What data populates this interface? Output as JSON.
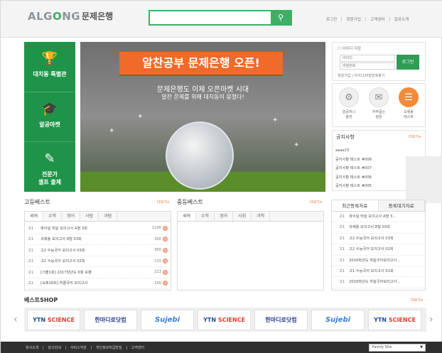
{
  "header": {
    "logo_text_a": "ALG",
    "logo_text_o": "O",
    "logo_text_b": "NG",
    "logo_sub": "문제은행",
    "search_placeholder": "",
    "search_icon": "search-icon",
    "nav": [
      "로그인",
      "회원가입",
      "고객센터",
      "알공소개"
    ]
  },
  "left_nav": [
    {
      "label": "대치동 특별관",
      "icon": "trophy-icon"
    },
    {
      "label": "알공마켓",
      "icon": "graduation-cap-icon"
    },
    {
      "label_line1": "전문가",
      "label_line2": "셀프 출제",
      "icon": "edit-icon"
    }
  ],
  "banner": {
    "title": "알찬공부 문제은행 오픈!",
    "line1": "문제은행도 이제 오픈마켓 시대",
    "line2": "알찬 문제를 위해 대치동이 뭉쳤다!"
  },
  "login": {
    "remember": "아이디 저장",
    "id_placeholder": "아이디",
    "pw_placeholder": "비밀번호",
    "button": "로그인",
    "signup": "회원가입",
    "find": "아이디/비밀번호찾기"
  },
  "quick_links": [
    {
      "label_line1": "알공머니",
      "label_line2": "충전",
      "icon": "coin-icon"
    },
    {
      "label_line1": "자주묻는",
      "label_line2": "질문",
      "icon": "chat-icon"
    },
    {
      "label_line1": "오랫동",
      "label_line2": "테스트",
      "icon": "document-icon"
    }
  ],
  "notice": {
    "title": "공지사항",
    "more": "더보기+",
    "items": [
      "aaaa23",
      "공지사항 테스트 #008",
      "공지사항 테스트 #007",
      "공지사항 테스트 #006",
      "공지사항 테스트 #005"
    ]
  },
  "high_best": {
    "title": "고등베스트",
    "more": "더보기+",
    "tabs": [
      "국어",
      "수학",
      "영어",
      "사탐",
      "과탐"
    ],
    "rows": [
      {
        "grade": "고1",
        "name": "파이널 하늘 모의고사 A형 3회",
        "count": "1100"
      },
      {
        "grade": "고1",
        "name": "과제용 모의고사 8형 03회",
        "count": "300"
      },
      {
        "grade": "고1",
        "name": "고2 수능국어 모의고사 03회",
        "count": "300"
      },
      {
        "grade": "고1",
        "name": "고2 수능국어 모의고사 02회",
        "count": "115"
      },
      {
        "grade": "고1",
        "name": "[기출1회] 2017학년도 6월 모평",
        "count": "222"
      },
      {
        "grade": "고1",
        "name": "[숙제16회] 허클국어 모의고사",
        "count": "100"
      }
    ]
  },
  "mid_best": {
    "title": "중등베스트",
    "more": "더보기+",
    "tabs": [
      "국어",
      "수학",
      "영어",
      "사회",
      "과학"
    ]
  },
  "recent": {
    "tab1": "최근등록자료",
    "tab2": "등록대기자료",
    "rows": [
      {
        "grade": "고1",
        "name": "파이널 하늘 모의고사 A형 3..."
      },
      {
        "grade": "고1",
        "name": "과제용 모의고사 8형 03회"
      },
      {
        "grade": "고1",
        "name": "고2 수능국어 모의고사 03회"
      },
      {
        "grade": "고1",
        "name": "고2 수능국어 모의고사 02회"
      },
      {
        "grade": "고1",
        "name": "2016학년도 하늘국어모의고사..."
      },
      {
        "grade": "고1",
        "name": "고1 수능국어 모의고사 01회"
      },
      {
        "grade": "고1",
        "name": "2016학년도 하늘국어모의고사..."
      }
    ]
  },
  "shop": {
    "title": "베스트SHOP",
    "more": "더보기+",
    "brands": [
      {
        "a": "YTN",
        "b": "SCIENCE",
        "type": "ytn"
      },
      {
        "a": "한마디로닷컴",
        "b": "",
        "type": "han"
      },
      {
        "a": "Sujebi",
        "b": "",
        "type": "sj"
      },
      {
        "a": "YTN",
        "b": "SCIENCE",
        "type": "ytn"
      },
      {
        "a": "한마디로닷컴",
        "b": "",
        "type": "han"
      },
      {
        "a": "Sujebi",
        "b": "",
        "type": "sj"
      },
      {
        "a": "YTN",
        "b": "SCIENCE",
        "type": "ytn"
      }
    ]
  },
  "footer": {
    "links": [
      "회사소개",
      "광고안내",
      "서비스약관",
      "개인정보취급방침",
      "고객센터"
    ],
    "family_site": "Family Site"
  }
}
